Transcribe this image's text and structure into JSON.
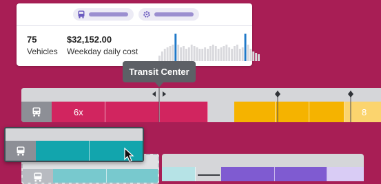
{
  "card": {
    "vehicles_count": "75",
    "vehicles_label": "Vehicles",
    "cost_value": "$32,152.00",
    "cost_label": "Weekday daily cost",
    "pills": [
      {
        "icon": "bus-icon"
      },
      {
        "icon": "gear-icon"
      }
    ],
    "sparkline": {
      "bar_color": "#d9d9dd",
      "highlight_color": "#1f78c8",
      "values": [
        0.2,
        0.35,
        0.45,
        0.5,
        0.55,
        0.6,
        1.0,
        0.6,
        0.5,
        0.55,
        0.45,
        0.5,
        0.6,
        0.55,
        0.5,
        0.45,
        0.45,
        0.5,
        0.45,
        0.55,
        0.6,
        0.55,
        0.45,
        0.5,
        0.55,
        0.6,
        0.5,
        0.45,
        0.55,
        0.6,
        0.45,
        0.5,
        1.0,
        0.6,
        0.45,
        0.35,
        0.3,
        0.25
      ],
      "highlight_indices": [
        6,
        32
      ]
    }
  },
  "tooltip": {
    "text": "Transit Center"
  },
  "track": {
    "segments": [
      {
        "label": "6x",
        "color": "#d1255f"
      },
      {
        "label": "",
        "color": "#d1255f"
      },
      {
        "label": "",
        "color": "#d5d6d9"
      },
      {
        "label": "",
        "color": "#f5b300"
      },
      {
        "label": "8",
        "color": "#fbd46e"
      }
    ]
  },
  "drag_block": {
    "color": "#12a5ad"
  },
  "placeholder": {
    "color": "#78c9ce"
  },
  "track2": {
    "colors": [
      "#b6e3e6",
      "#d5d6d9",
      "#7f5bd1",
      "#7f5bd1",
      "#d9ccf5"
    ]
  },
  "colors": {
    "background": "#a81e55",
    "tooltip": "#5d6066",
    "bus_tile": "#8d8f96"
  }
}
